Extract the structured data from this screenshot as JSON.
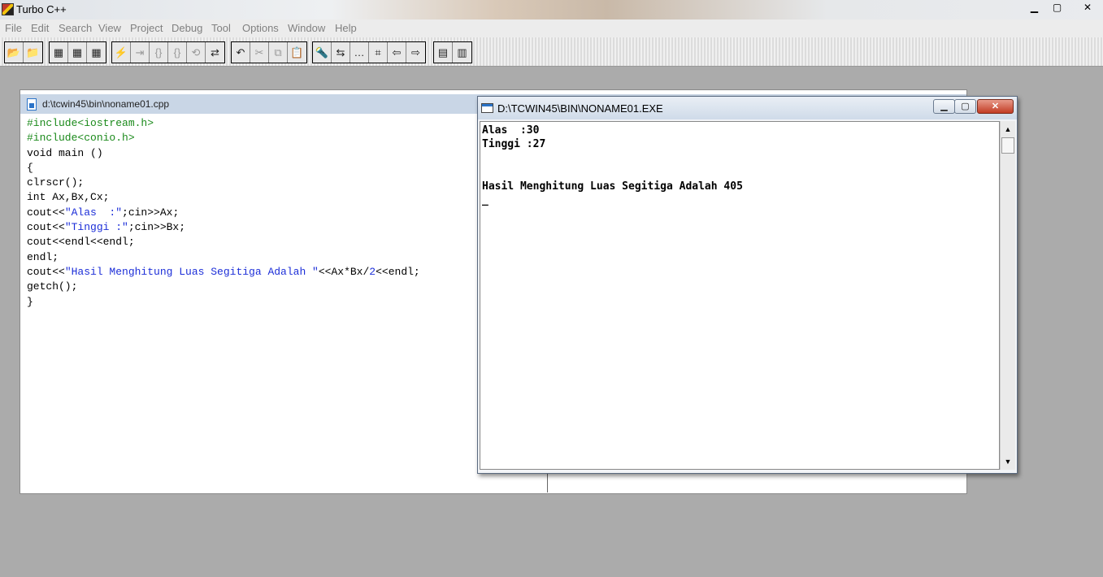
{
  "app": {
    "title": "Turbo C++"
  },
  "window_controls": {
    "minimize": "▁",
    "maximize": "▢",
    "close": "✕"
  },
  "menu": [
    "File",
    "Edit",
    "Search",
    "View",
    "Project",
    "Debug",
    "Tool",
    "Options",
    "Window",
    "Help"
  ],
  "toolbar": {
    "groups": [
      {
        "buttons": [
          {
            "icon": "open-project-icon",
            "glyph": "📂",
            "enabled": true
          },
          {
            "icon": "close-project-icon",
            "glyph": "📁",
            "enabled": false
          }
        ]
      },
      {
        "buttons": [
          {
            "icon": "compile-icon",
            "glyph": "▦",
            "enabled": true
          },
          {
            "icon": "make-icon",
            "glyph": "▦",
            "enabled": true
          },
          {
            "icon": "build-icon",
            "glyph": "▦",
            "enabled": true
          }
        ]
      },
      {
        "buttons": [
          {
            "icon": "run-icon",
            "glyph": "⚡",
            "enabled": false
          },
          {
            "icon": "step-over-icon",
            "glyph": "⇥",
            "enabled": false
          },
          {
            "icon": "trace-into-icon",
            "glyph": "{}",
            "enabled": false
          },
          {
            "icon": "go-to-cursor-icon",
            "glyph": "{}",
            "enabled": false
          },
          {
            "icon": "reset-icon",
            "glyph": "⟲",
            "enabled": false
          },
          {
            "icon": "toggle-breakpoint-icon",
            "glyph": "⇄",
            "enabled": true
          }
        ]
      },
      {
        "buttons": [
          {
            "icon": "undo-icon",
            "glyph": "↶",
            "enabled": true
          },
          {
            "icon": "cut-icon",
            "glyph": "✂",
            "enabled": false
          },
          {
            "icon": "copy-icon",
            "glyph": "⧉",
            "enabled": false
          },
          {
            "icon": "paste-icon",
            "glyph": "📋",
            "enabled": true
          }
        ]
      },
      {
        "buttons": [
          {
            "icon": "find-icon",
            "glyph": "🔦",
            "enabled": true
          },
          {
            "icon": "replace-icon",
            "glyph": "⇆",
            "enabled": true
          },
          {
            "icon": "search-again-icon",
            "glyph": "…",
            "enabled": true
          },
          {
            "icon": "browse-icon",
            "glyph": "⌗",
            "enabled": true
          },
          {
            "icon": "prev-message-icon",
            "glyph": "⇦",
            "enabled": true
          },
          {
            "icon": "next-message-icon",
            "glyph": "⇨",
            "enabled": true
          }
        ]
      },
      {
        "buttons": [
          {
            "icon": "tile-window-icon",
            "glyph": "▤",
            "enabled": true
          },
          {
            "icon": "cascade-window-icon",
            "glyph": "▥",
            "enabled": true
          }
        ]
      }
    ]
  },
  "editor": {
    "title": "d:\\tcwin45\\bin\\noname01.cpp",
    "code": [
      [
        {
          "t": "#include<iostream.h>",
          "c": "g"
        }
      ],
      [
        {
          "t": "#include<conio.h>",
          "c": "g"
        }
      ],
      [
        {
          "t": "void main ()",
          "c": ""
        }
      ],
      [
        {
          "t": "{",
          "c": ""
        }
      ],
      [
        {
          "t": "clrscr();",
          "c": ""
        }
      ],
      [
        {
          "t": "int Ax,Bx,Cx;",
          "c": ""
        }
      ],
      [
        {
          "t": "cout<<",
          "c": ""
        },
        {
          "t": "\"Alas  :\"",
          "c": "b"
        },
        {
          "t": ";cin>>Ax;",
          "c": ""
        }
      ],
      [
        {
          "t": "cout<<",
          "c": ""
        },
        {
          "t": "\"Tinggi :\"",
          "c": "b"
        },
        {
          "t": ";cin>>Bx;",
          "c": ""
        }
      ],
      [
        {
          "t": "cout<<endl<<endl;",
          "c": ""
        }
      ],
      [
        {
          "t": "endl;",
          "c": ""
        }
      ],
      [
        {
          "t": "cout<<",
          "c": ""
        },
        {
          "t": "\"Hasil Menghitung Luas Segitiga Adalah \"",
          "c": "b"
        },
        {
          "t": "<<Ax*Bx/",
          "c": ""
        },
        {
          "t": "2",
          "c": "b"
        },
        {
          "t": "<<endl;",
          "c": ""
        }
      ],
      [
        {
          "t": "getch();",
          "c": ""
        }
      ],
      [
        {
          "t": "}",
          "c": ""
        }
      ]
    ]
  },
  "console": {
    "title": "D:\\TCWIN45\\BIN\\NONAME01.EXE",
    "lines": [
      "Alas  :30",
      "Tinggi :27",
      "",
      "",
      "Hasil Menghitung Luas Segitiga Adalah 405",
      "_"
    ],
    "controls": {
      "minimize": "▁",
      "maximize": "▢",
      "close": "✕"
    },
    "scroll": {
      "up": "▲",
      "down": "▼"
    }
  }
}
